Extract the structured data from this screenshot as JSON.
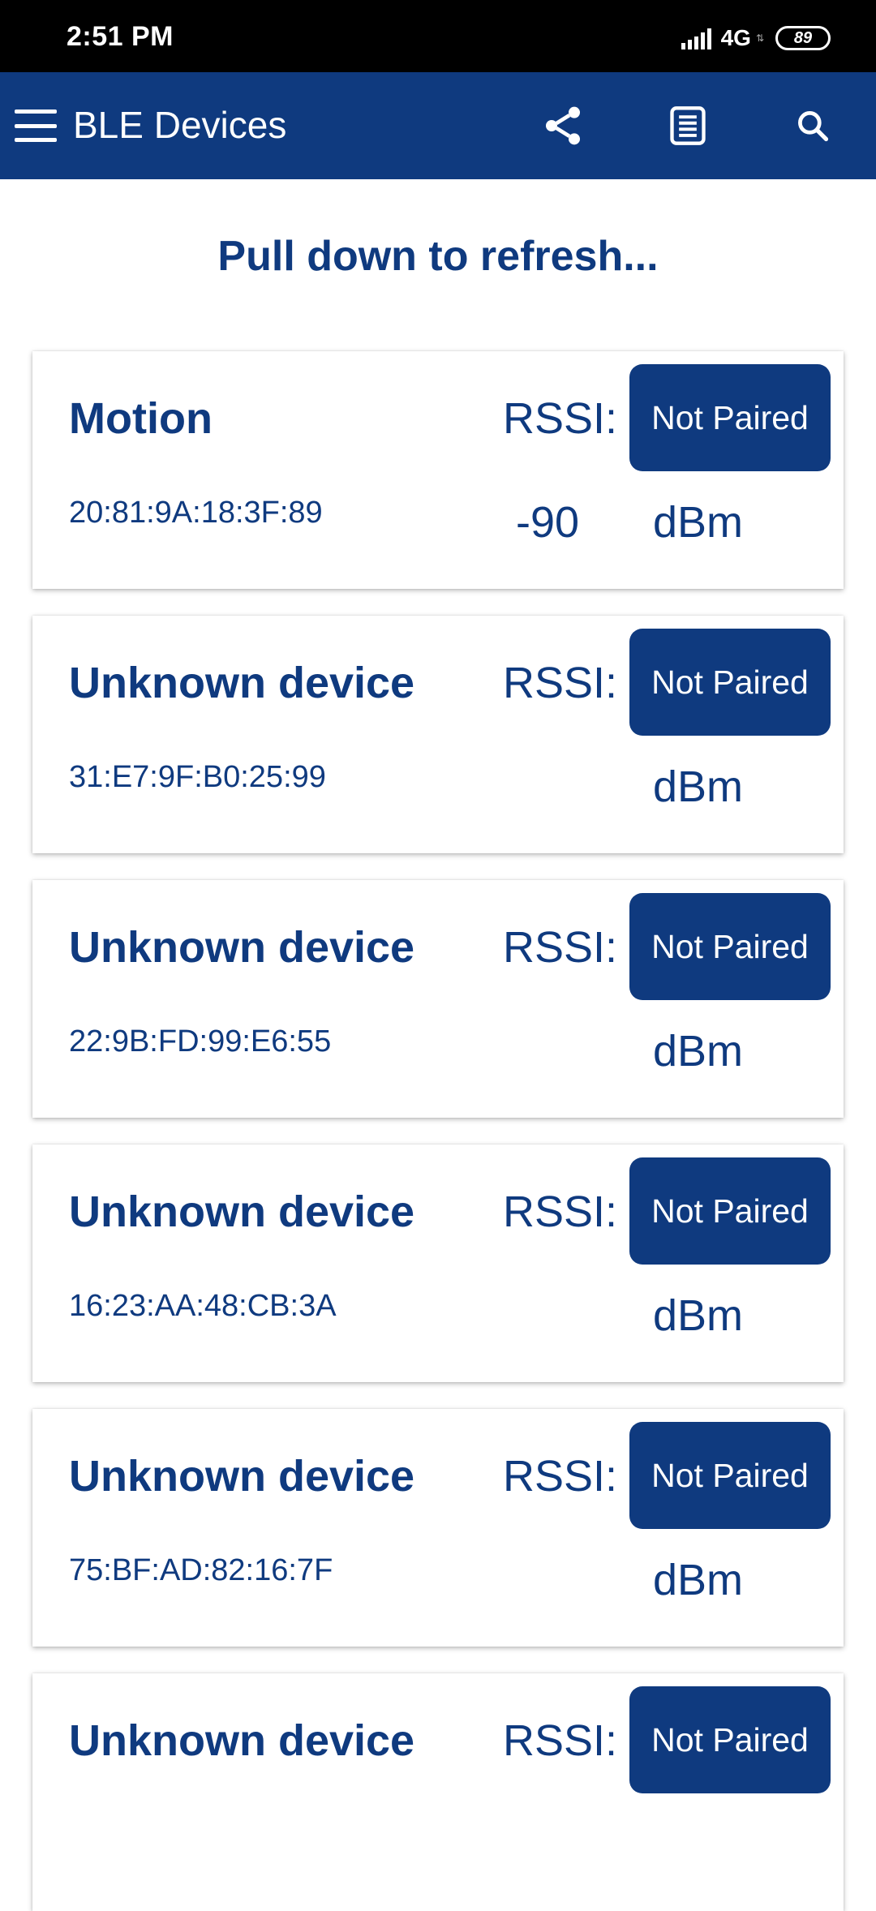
{
  "status_bar": {
    "time": "2:51 PM",
    "network": "4G",
    "battery": "89"
  },
  "app_bar": {
    "title": "BLE Devices",
    "icons": [
      "menu-icon",
      "share-icon",
      "list-icon",
      "search-icon"
    ]
  },
  "refresh_hint": "Pull down to refresh...",
  "colors": {
    "primary": "#0f3a7f",
    "status_bar": "#000000",
    "background": "#ffffff"
  },
  "devices": [
    {
      "name": "Motion",
      "mac": "20:81:9A:18:3F:89",
      "rssi_label": "RSSI:",
      "rssi_value": "-90",
      "unit": "dBm",
      "pair_status": "Not Paired"
    },
    {
      "name": "Unknown device",
      "mac": "31:E7:9F:B0:25:99",
      "rssi_label": "RSSI:",
      "rssi_value": "",
      "unit": "dBm",
      "pair_status": "Not Paired"
    },
    {
      "name": "Unknown device",
      "mac": "22:9B:FD:99:E6:55",
      "rssi_label": "RSSI:",
      "rssi_value": "",
      "unit": "dBm",
      "pair_status": "Not Paired"
    },
    {
      "name": "Unknown device",
      "mac": "16:23:AA:48:CB:3A",
      "rssi_label": "RSSI:",
      "rssi_value": "",
      "unit": "dBm",
      "pair_status": "Not Paired"
    },
    {
      "name": "Unknown device",
      "mac": "75:BF:AD:82:16:7F",
      "rssi_label": "RSSI:",
      "rssi_value": "",
      "unit": "dBm",
      "pair_status": "Not Paired"
    },
    {
      "name": "Unknown device",
      "mac": "",
      "rssi_label": "RSSI:",
      "rssi_value": "",
      "unit": "",
      "pair_status": "Not Paired"
    }
  ]
}
